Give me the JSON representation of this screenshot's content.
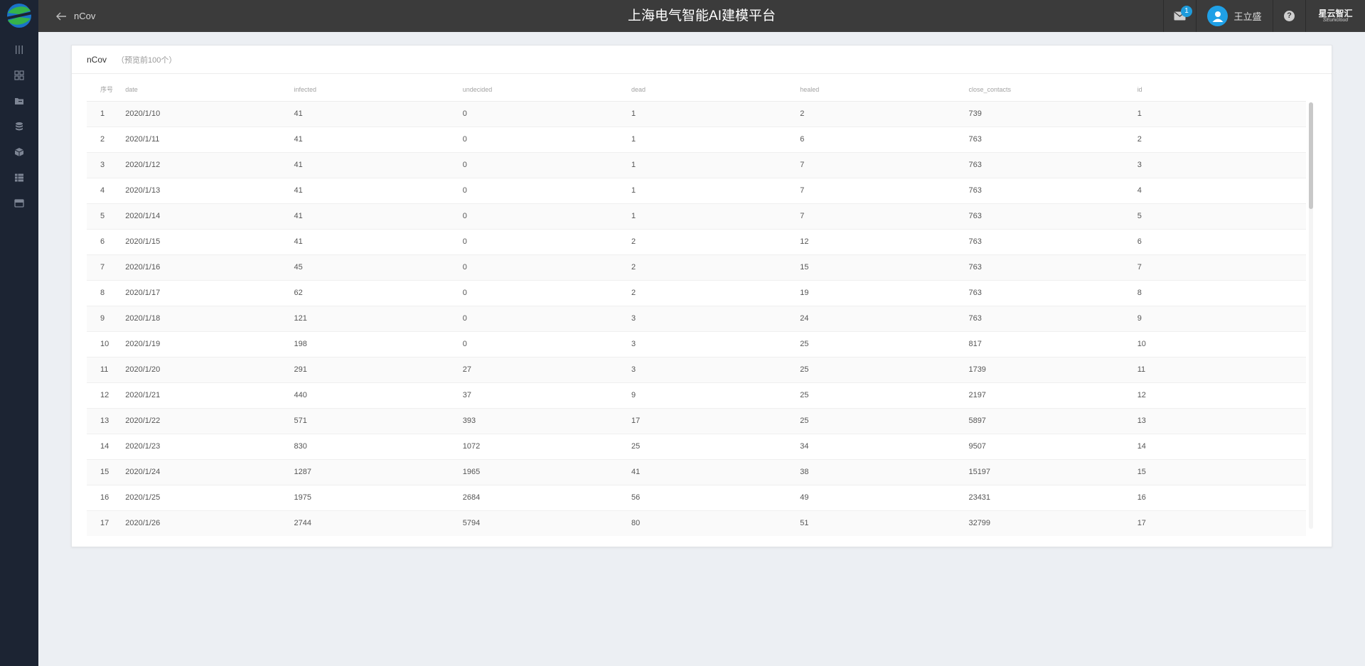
{
  "header": {
    "back_label": "nCov",
    "app_title": "上海电气智能AI建模平台",
    "notification_count": "1",
    "user_name": "王立盛",
    "help_symbol": "?",
    "brand_main": "星云智汇",
    "brand_sub": "SEunicloud"
  },
  "sidebar": {
    "icons": [
      "menu-toggle-icon",
      "dashboard-icon",
      "folder-icon",
      "database-icon",
      "cube-icon",
      "table-icon",
      "storage-icon"
    ]
  },
  "card": {
    "title": "nCov",
    "subtitle": "（预览前100个）"
  },
  "table": {
    "columns": [
      "序号",
      "date",
      "infected",
      "undecided",
      "dead",
      "healed",
      "close_contacts",
      "id"
    ],
    "rows": [
      [
        "1",
        "2020/1/10",
        "41",
        "0",
        "1",
        "2",
        "739",
        "1"
      ],
      [
        "2",
        "2020/1/11",
        "41",
        "0",
        "1",
        "6",
        "763",
        "2"
      ],
      [
        "3",
        "2020/1/12",
        "41",
        "0",
        "1",
        "7",
        "763",
        "3"
      ],
      [
        "4",
        "2020/1/13",
        "41",
        "0",
        "1",
        "7",
        "763",
        "4"
      ],
      [
        "5",
        "2020/1/14",
        "41",
        "0",
        "1",
        "7",
        "763",
        "5"
      ],
      [
        "6",
        "2020/1/15",
        "41",
        "0",
        "2",
        "12",
        "763",
        "6"
      ],
      [
        "7",
        "2020/1/16",
        "45",
        "0",
        "2",
        "15",
        "763",
        "7"
      ],
      [
        "8",
        "2020/1/17",
        "62",
        "0",
        "2",
        "19",
        "763",
        "8"
      ],
      [
        "9",
        "2020/1/18",
        "121",
        "0",
        "3",
        "24",
        "763",
        "9"
      ],
      [
        "10",
        "2020/1/19",
        "198",
        "0",
        "3",
        "25",
        "817",
        "10"
      ],
      [
        "11",
        "2020/1/20",
        "291",
        "27",
        "3",
        "25",
        "1739",
        "11"
      ],
      [
        "12",
        "2020/1/21",
        "440",
        "37",
        "9",
        "25",
        "2197",
        "12"
      ],
      [
        "13",
        "2020/1/22",
        "571",
        "393",
        "17",
        "25",
        "5897",
        "13"
      ],
      [
        "14",
        "2020/1/23",
        "830",
        "1072",
        "25",
        "34",
        "9507",
        "14"
      ],
      [
        "15",
        "2020/1/24",
        "1287",
        "1965",
        "41",
        "38",
        "15197",
        "15"
      ],
      [
        "16",
        "2020/1/25",
        "1975",
        "2684",
        "56",
        "49",
        "23431",
        "16"
      ],
      [
        "17",
        "2020/1/26",
        "2744",
        "5794",
        "80",
        "51",
        "32799",
        "17"
      ]
    ]
  },
  "colors": {
    "sidebar_bg": "#1c2433",
    "header_bg": "#3b3b3b",
    "accent": "#1e9bdb",
    "page_bg": "#eceff3"
  }
}
